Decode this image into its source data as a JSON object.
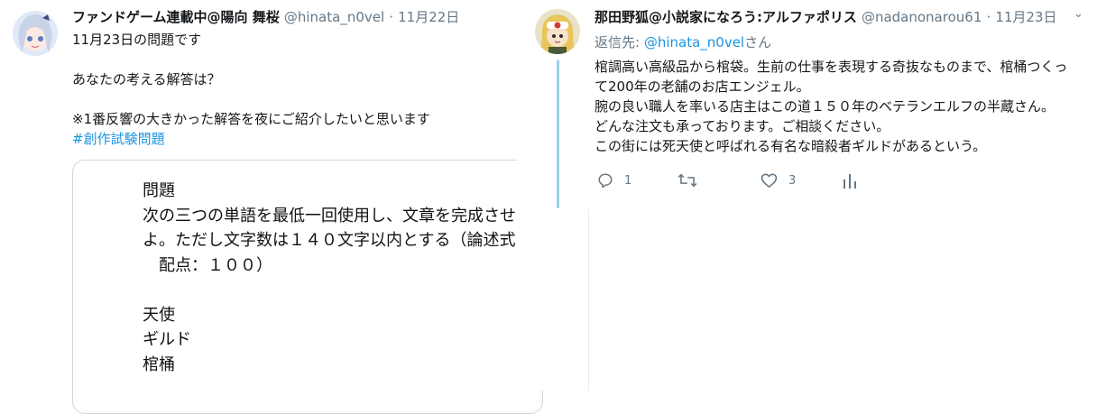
{
  "left_tweet": {
    "author_name": "ファンドゲーム連載中@陽向 舞桜",
    "handle": "@hinata_n0vel",
    "separator": "·",
    "date": "11月22日",
    "lines": [
      "11月23日の問題です",
      "あなたの考える解答は？",
      "※1番反響の大きかった解答を夜にご紹介したいと思います"
    ],
    "hashtag": "#創作試験問題",
    "image_text": {
      "title": "問題",
      "line1": "次の三つの単語を最低一回使用し、文章を完成させ",
      "line2": "よ。ただし文字数は１４０文字以内とする（論述式",
      "line3": "　配点：１００）",
      "word1": "天使",
      "word2": "ギルド",
      "word3": "棺桶"
    }
  },
  "right_tweet": {
    "author_name": "那田野狐@小説家になろう:アルファポリス",
    "handle": "@nadanonarou61",
    "separator": "·",
    "date": "11月23日",
    "caret": "⌄",
    "reply_prefix": "返信先: ",
    "reply_mention": "@hinata_n0vel",
    "reply_suffix": "さん",
    "lines": [
      "棺調高い高級品から棺袋。生前の仕事を表現する奇抜なものまで、棺桶つくっ",
      "て200年の老舗のお店エンジェル。",
      "腕の良い職人を率いる店主はこの道１５０年のベテランエルフの半蔵さん。",
      "どんな注文も承っております。ご相談ください。",
      "この街には死天使と呼ばれる有名な暗殺者ギルドがあるという。"
    ],
    "actions": {
      "reply_count": "1",
      "retweet_count": "",
      "like_count": "3"
    }
  },
  "colors": {
    "link": "#1b95e0",
    "secondary": "#657786",
    "thread_line": "#9ed0e8"
  }
}
